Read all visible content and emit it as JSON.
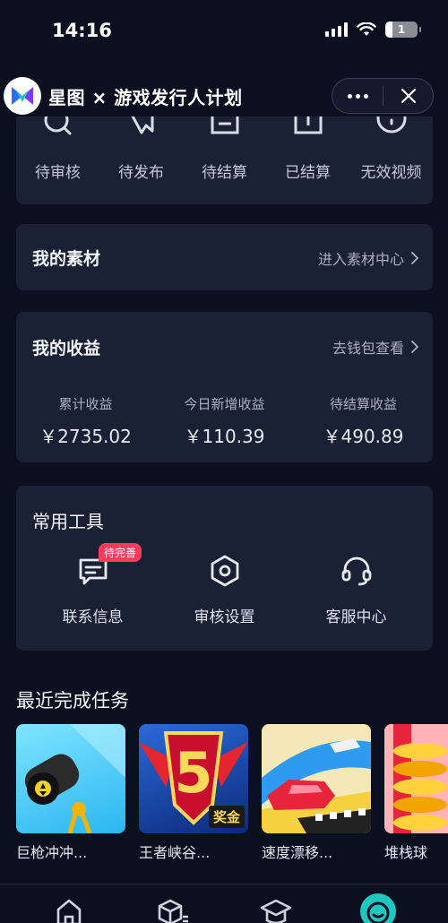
{
  "status_bar": {
    "time": "14:16",
    "battery": "1"
  },
  "header": {
    "title": "星图 × 游戏发行人计划"
  },
  "video_status": [
    {
      "label": "待审核",
      "icon": "search-icon"
    },
    {
      "label": "待发布",
      "icon": "star-icon"
    },
    {
      "label": "待结算",
      "icon": "document-icon"
    },
    {
      "label": "已结算",
      "icon": "document-check-icon"
    },
    {
      "label": "无效视频",
      "icon": "invalid-icon"
    }
  ],
  "material": {
    "title": "我的素材",
    "link": "进入素材中心"
  },
  "earnings": {
    "title": "我的收益",
    "link": "去钱包查看",
    "items": [
      {
        "label": "累计收益",
        "value": "￥2735.02"
      },
      {
        "label": "今日新增收益",
        "value": "￥110.39"
      },
      {
        "label": "待结算收益",
        "value": "￥490.89"
      }
    ]
  },
  "tools": {
    "title": "常用工具",
    "items": [
      {
        "label": "联系信息",
        "badge": "待完善",
        "icon": "contact-info-icon"
      },
      {
        "label": "审核设置",
        "icon": "settings-hex-icon"
      },
      {
        "label": "客服中心",
        "icon": "headset-icon"
      }
    ]
  },
  "recent_tasks": {
    "title": "最近完成任务",
    "items": [
      {
        "name": "巨枪冲冲..."
      },
      {
        "name": "王者峡谷...",
        "thumb_text": "5",
        "thumb_tag": "奖金"
      },
      {
        "name": "速度漂移..."
      },
      {
        "name": "堆栈球"
      }
    ]
  },
  "bottom_nav": [
    "home-icon",
    "box-list-icon",
    "graduation-cap-icon",
    "profile-face-icon"
  ],
  "colors": {
    "background": "#0b1020",
    "card": "#1a2134",
    "accent": "#1fc7c0",
    "badge": "#ff3a5f"
  }
}
